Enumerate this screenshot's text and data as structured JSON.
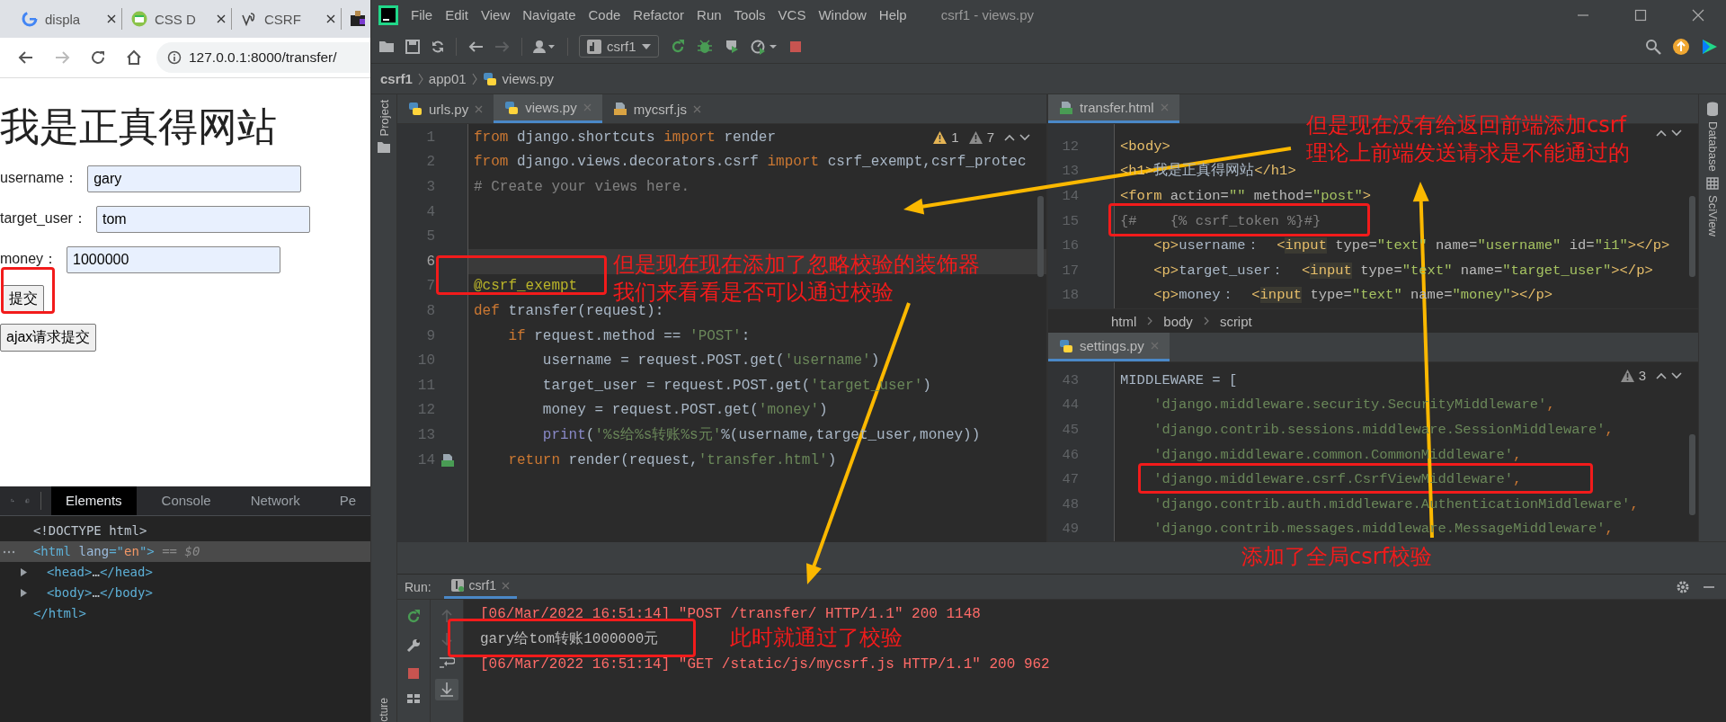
{
  "browser": {
    "tabs": [
      "displa",
      "CSS D",
      "CSRF"
    ],
    "url": "127.0.0.1:8000/transfer/",
    "page": {
      "heading": "我是正真得网站",
      "fields": [
        {
          "label": "username：",
          "value": "gary"
        },
        {
          "label": "target_user：",
          "value": "tom"
        },
        {
          "label": "money：",
          "value": "1000000"
        }
      ],
      "buttons": [
        "提交",
        "ajax请求提交"
      ]
    }
  },
  "devtools": {
    "tabs": [
      {
        "label": "Elements",
        "selected": true
      },
      {
        "label": "Console",
        "selected": false
      },
      {
        "label": "Network",
        "selected": false
      },
      {
        "label": "Pe",
        "selected": false
      }
    ],
    "dom": [
      {
        "selected": false,
        "expandable": false,
        "tokens": [
          {
            "text": "<!DOCTYPE html>",
            "kind": "doctype"
          }
        ]
      },
      {
        "selected": true,
        "expandable": false,
        "tokens": [
          {
            "text": "<html",
            "kind": "tag"
          },
          {
            "text": " lang",
            "kind": "attr"
          },
          {
            "text": "=\"",
            "kind": "tag"
          },
          {
            "text": "en",
            "kind": "value"
          },
          {
            "text": "\">",
            "kind": "tag"
          },
          {
            "text": " == $0",
            "kind": "dim"
          }
        ],
        "children": [
          {
            "selected": false,
            "expandable": true,
            "tokens": [
              {
                "text": "<head>",
                "kind": "tag"
              },
              {
                "text": "…",
                "kind": "doctype"
              },
              {
                "text": "</head>",
                "kind": "tag"
              }
            ]
          },
          {
            "selected": false,
            "expandable": true,
            "tokens": [
              {
                "text": "<body>",
                "kind": "tag"
              },
              {
                "text": "…",
                "kind": "doctype"
              },
              {
                "text": "</body>",
                "kind": "tag"
              }
            ]
          }
        ]
      },
      {
        "selected": false,
        "expandable": false,
        "tokens": [
          {
            "text": "</html>",
            "kind": "tag"
          }
        ]
      }
    ]
  },
  "ide": {
    "menu": [
      "File",
      "Edit",
      "View",
      "Navigate",
      "Code",
      "Refactor",
      "Run",
      "Tools",
      "VCS",
      "Window",
      "Help"
    ],
    "title": "csrf1 - views.py",
    "run_config": "csrf1",
    "breadcrumb": [
      "csrf1",
      "app01",
      "views.py"
    ],
    "left_tools": [
      "Project"
    ],
    "left_bottom_tool": "cture",
    "right_tools": [
      "Database",
      "SciView"
    ],
    "editors": [
      {
        "tabs": [
          {
            "label": "urls.py",
            "kind": "py",
            "selected": false
          },
          {
            "label": "views.py",
            "kind": "py",
            "selected": true
          },
          {
            "label": "mycsrf.js",
            "kind": "js",
            "selected": false
          }
        ],
        "warnings": [
          {
            "count": "1",
            "kind": "warning"
          },
          {
            "count": "7",
            "kind": "weak"
          }
        ],
        "lines": [
          {
            "n": "1",
            "current": false,
            "tokens": [
              {
                "text": "from",
                "kind": "keyword"
              },
              {
                "text": " django.shortcuts ",
                "kind": "plain"
              },
              {
                "text": "import",
                "kind": "keyword"
              },
              {
                "text": " render",
                "kind": "plain"
              }
            ]
          },
          {
            "n": "2",
            "current": false,
            "tokens": [
              {
                "text": "from",
                "kind": "keyword"
              },
              {
                "text": " django.views.decorators.csrf ",
                "kind": "plain"
              },
              {
                "text": "import",
                "kind": "keyword"
              },
              {
                "text": " csrf_exempt,csrf_protec",
                "kind": "plain"
              }
            ]
          },
          {
            "n": "3",
            "current": false,
            "tokens": [
              {
                "text": "# Create your views here.",
                "kind": "comment"
              }
            ]
          },
          {
            "n": "4",
            "current": false
          },
          {
            "n": "5",
            "current": false
          },
          {
            "n": "6",
            "current": true
          },
          {
            "n": "7",
            "current": false,
            "tokens": [
              {
                "text": "@csrf_exempt",
                "kind": "decorator"
              }
            ]
          },
          {
            "n": "8",
            "current": false,
            "tokens": [
              {
                "text": "def",
                "kind": "keyword"
              },
              {
                "text": " transfer(request):",
                "kind": "plain"
              }
            ]
          },
          {
            "n": "9",
            "current": false,
            "tokens": [
              {
                "text": "    if",
                "kind": "keyword"
              },
              {
                "text": " request.method == ",
                "kind": "plain"
              },
              {
                "text": "'POST'",
                "kind": "string"
              },
              {
                "text": ":",
                "kind": "plain"
              }
            ]
          },
          {
            "n": "10",
            "current": false,
            "tokens": [
              {
                "text": "        username = request.POST.get(",
                "kind": "plain"
              },
              {
                "text": "'username'",
                "kind": "string"
              },
              {
                "text": ")",
                "kind": "plain"
              }
            ]
          },
          {
            "n": "11",
            "current": false,
            "tokens": [
              {
                "text": "        target_user = request.POST.get(",
                "kind": "plain"
              },
              {
                "text": "'target_user'",
                "kind": "string"
              },
              {
                "text": ")",
                "kind": "plain"
              }
            ]
          },
          {
            "n": "12",
            "current": false,
            "tokens": [
              {
                "text": "        money = request.POST.get(",
                "kind": "plain"
              },
              {
                "text": "'money'",
                "kind": "string"
              },
              {
                "text": ")",
                "kind": "plain"
              }
            ]
          },
          {
            "n": "13",
            "current": false,
            "tokens": [
              {
                "text": "        print",
                "kind": "builtin"
              },
              {
                "text": "(",
                "kind": "plain"
              },
              {
                "text": "'%s给%s转账%s元'",
                "kind": "string"
              },
              {
                "text": "%(username,target_user,money))",
                "kind": "plain"
              }
            ]
          },
          {
            "n": "14",
            "current": false,
            "linked": true,
            "tokens": [
              {
                "text": "    return",
                "kind": "keyword"
              },
              {
                "text": " render(request,",
                "kind": "plain"
              },
              {
                "text": "'transfer.html'",
                "kind": "string"
              },
              {
                "text": ")",
                "kind": "plain"
              }
            ]
          }
        ]
      },
      {
        "tabs": [
          {
            "label": "transfer.html",
            "kind": "html",
            "selected": true
          }
        ],
        "lines": [
          {
            "n": "12",
            "tokens": [
              {
                "text": "<body>",
                "kind": "tag"
              }
            ]
          },
          {
            "n": "13",
            "tokens": [
              {
                "text": "<h1>",
                "kind": "tag"
              },
              {
                "text": "我是正真得网站",
                "kind": "plain"
              },
              {
                "text": "</h1>",
                "kind": "tag"
              }
            ]
          },
          {
            "n": "14",
            "tokens": [
              {
                "text": "<form ",
                "kind": "tag"
              },
              {
                "text": "action=",
                "kind": "attr"
              },
              {
                "text": "\"\"",
                "kind": "value"
              },
              {
                "text": " method=",
                "kind": "attr"
              },
              {
                "text": "\"post\"",
                "kind": "value"
              },
              {
                "text": ">",
                "kind": "tag"
              }
            ]
          },
          {
            "n": "15",
            "tokens": [
              {
                "text": "{#    {% csrf_token %}#}",
                "kind": "comment"
              }
            ]
          },
          {
            "n": "16",
            "tokens": [
              {
                "text": "    <p>",
                "kind": "tag"
              },
              {
                "text": "username：  ",
                "kind": "plain"
              },
              {
                "text": "<",
                "kind": "tag"
              },
              {
                "text": "input",
                "kind": "marked"
              },
              {
                "text": " type=",
                "kind": "attr"
              },
              {
                "text": "\"text\"",
                "kind": "value"
              },
              {
                "text": " name=",
                "kind": "attr"
              },
              {
                "text": "\"username\"",
                "kind": "value"
              },
              {
                "text": " id=",
                "kind": "attr"
              },
              {
                "text": "\"i1\"",
                "kind": "value"
              },
              {
                "text": "></p>",
                "kind": "tag"
              }
            ]
          },
          {
            "n": "17",
            "tokens": [
              {
                "text": "    <p>",
                "kind": "tag"
              },
              {
                "text": "target_user：  ",
                "kind": "plain"
              },
              {
                "text": "<",
                "kind": "tag"
              },
              {
                "text": "input",
                "kind": "marked"
              },
              {
                "text": " type=",
                "kind": "attr"
              },
              {
                "text": "\"text\"",
                "kind": "value"
              },
              {
                "text": " name=",
                "kind": "attr"
              },
              {
                "text": "\"target_user\"",
                "kind": "value"
              },
              {
                "text": "></p>",
                "kind": "tag"
              }
            ]
          },
          {
            "n": "18",
            "tokens": [
              {
                "text": "    <p>",
                "kind": "tag"
              },
              {
                "text": "money：  ",
                "kind": "plain"
              },
              {
                "text": "<",
                "kind": "tag"
              },
              {
                "text": "input",
                "kind": "marked"
              },
              {
                "text": " type=",
                "kind": "attr"
              },
              {
                "text": "\"text\"",
                "kind": "value"
              },
              {
                "text": " name=",
                "kind": "attr"
              },
              {
                "text": "\"money\"",
                "kind": "value"
              },
              {
                "text": "></p>",
                "kind": "tag"
              }
            ]
          }
        ]
      },
      {
        "tabs": [
          {
            "label": "settings.py",
            "kind": "py",
            "selected": true
          }
        ],
        "warnings": [
          {
            "count": "3",
            "kind": "weak"
          }
        ],
        "lines": [
          {
            "n": "43",
            "tokens": [
              {
                "text": "MIDDLEWARE = [",
                "kind": "plain"
              }
            ]
          },
          {
            "n": "44",
            "tokens": [
              {
                "text": "    'django.middleware.security.SecurityMiddleware'",
                "kind": "string"
              },
              {
                "text": ",",
                "kind": "keyword"
              }
            ]
          },
          {
            "n": "45",
            "tokens": [
              {
                "text": "    'django.contrib.sessions.middleware.SessionMiddleware'",
                "kind": "string"
              },
              {
                "text": ",",
                "kind": "keyword"
              }
            ]
          },
          {
            "n": "46",
            "tokens": [
              {
                "text": "    'django.middleware.common.CommonMiddleware'",
                "kind": "string"
              },
              {
                "text": ",",
                "kind": "keyword"
              }
            ]
          },
          {
            "n": "47",
            "tokens": [
              {
                "text": "    'django.middleware.csrf.CsrfViewMiddleware'",
                "kind": "string"
              },
              {
                "text": ",",
                "kind": "keyword"
              }
            ]
          },
          {
            "n": "48",
            "tokens": [
              {
                "text": "    'django.contrib.auth.middleware.AuthenticationMiddleware'",
                "kind": "string"
              },
              {
                "text": ",",
                "kind": "keyword"
              }
            ]
          },
          {
            "n": "49",
            "tokens": [
              {
                "text": "    'django.contrib.messages.middleware.MessageMiddleware'",
                "kind": "string"
              },
              {
                "text": ",",
                "kind": "keyword"
              }
            ]
          }
        ]
      }
    ],
    "html_breadcrumb": [
      "html",
      "body",
      "script"
    ],
    "run": {
      "label": "Run:",
      "tab": "csrf1",
      "output": [
        {
          "kind": "error",
          "text": "[06/Mar/2022 16:51:14] \"POST /transfer/ HTTP/1.1\" 200 1148"
        },
        {
          "kind": "normal",
          "text": "gary给tom转账1000000元"
        },
        {
          "kind": "error",
          "text": "[06/Mar/2022 16:51:14] \"GET /static/js/mycsrf.js HTTP/1.1\" 200 962"
        }
      ]
    }
  },
  "annotations": [
    {
      "lines": [
        "但是现在没有给返回前端添加csrf",
        "理论上前端发送请求是不能通过的"
      ]
    },
    {
      "lines": [
        "但是现在现在添加了忽略校验的装饰器",
        "我们来看看是否可以通过校验"
      ]
    },
    {
      "lines": [
        "添加了全局csrf校验"
      ]
    },
    {
      "lines": [
        "此时就通过了校验"
      ]
    }
  ]
}
